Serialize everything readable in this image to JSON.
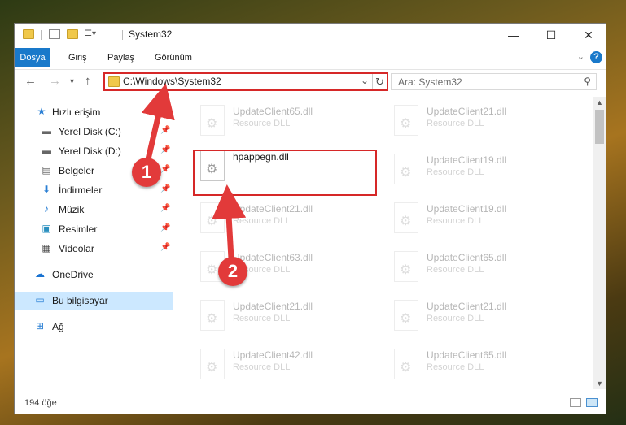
{
  "window": {
    "title": "System32",
    "controls": {
      "minimize": "—",
      "maximize": "☐",
      "close": "✕"
    }
  },
  "ribbon": {
    "tabs": [
      "Dosya",
      "Giriş",
      "Paylaş",
      "Görünüm"
    ],
    "help": "?"
  },
  "nav": {
    "address": "C:\\Windows\\System32",
    "search_placeholder": "Ara: System32"
  },
  "sidebar": {
    "items": [
      {
        "label": "Hızlı erişim",
        "icon": "star-icon"
      },
      {
        "label": "Yerel Disk (C:)",
        "icon": "drive-icon"
      },
      {
        "label": "Yerel Disk (D:)",
        "icon": "drive-icon"
      },
      {
        "label": "Belgeler",
        "icon": "documents-icon"
      },
      {
        "label": "İndirmeler",
        "icon": "download-icon"
      },
      {
        "label": "Müzik",
        "icon": "music-icon"
      },
      {
        "label": "Resimler",
        "icon": "pictures-icon"
      },
      {
        "label": "Videolar",
        "icon": "videos-icon"
      },
      {
        "label": "OneDrive",
        "icon": "cloud-icon"
      },
      {
        "label": "Bu bilgisayar",
        "icon": "computer-icon"
      },
      {
        "label": "Ağ",
        "icon": "network-icon"
      }
    ]
  },
  "files": {
    "left": [
      {
        "name": "UpdateClient65.dll",
        "type": "Resource DLL"
      },
      {
        "name": "hpappegn.dll",
        "type": ""
      },
      {
        "name": "UpdateClient21.dll",
        "type": "Resource DLL"
      },
      {
        "name": "UpdateClient63.dll",
        "type": "Resource DLL"
      },
      {
        "name": "UpdateClient21.dll",
        "type": "Resource DLL"
      },
      {
        "name": "UpdateClient42.dll",
        "type": "Resource DLL"
      }
    ],
    "right": [
      {
        "name": "UpdateClient21.dll",
        "type": "Resource DLL"
      },
      {
        "name": "UpdateClient19.dll",
        "type": "Resource DLL"
      },
      {
        "name": "UpdateClient19.dll",
        "type": "Resource DLL"
      },
      {
        "name": "UpdateClient65.dll",
        "type": "Resource DLL"
      },
      {
        "name": "UpdateClient21.dll",
        "type": "Resource DLL"
      },
      {
        "name": "UpdateClient65.dll",
        "type": "Resource DLL"
      }
    ]
  },
  "status": {
    "count": "194 öğe"
  },
  "annotations": {
    "step1": "1",
    "step2": "2"
  },
  "colors": {
    "accent": "#1979ca",
    "highlight": "#d62828",
    "selected": "#cce8ff"
  }
}
